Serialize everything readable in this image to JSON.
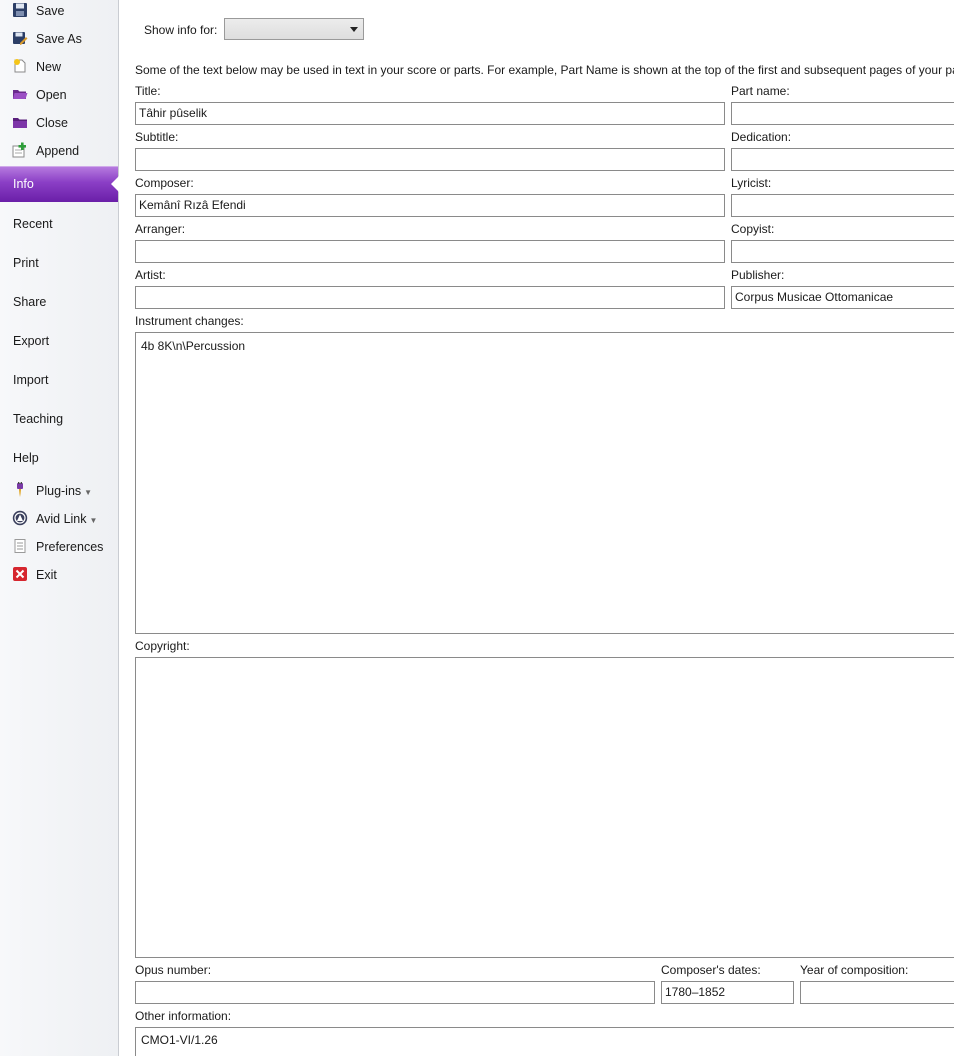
{
  "sidebar": {
    "file_items": [
      {
        "label": "Save",
        "icon": "save-icon"
      },
      {
        "label": "Save As",
        "icon": "save-as-icon"
      },
      {
        "label": "New",
        "icon": "new-icon"
      },
      {
        "label": "Open",
        "icon": "open-folder-icon"
      },
      {
        "label": "Close",
        "icon": "close-folder-icon"
      },
      {
        "label": "Append",
        "icon": "append-icon"
      }
    ],
    "nav": {
      "info": "Info",
      "recent": "Recent",
      "print": "Print",
      "share": "Share",
      "export": "Export",
      "import": "Import",
      "teaching": "Teaching",
      "help": "Help"
    },
    "bottom_items": [
      {
        "label": "Plug-ins",
        "icon": "plugins-icon"
      },
      {
        "label": "Avid Link",
        "icon": "avid-link-icon"
      },
      {
        "label": "Preferences",
        "icon": "preferences-icon"
      },
      {
        "label": "Exit",
        "icon": "exit-icon"
      }
    ],
    "active_color": "#8b3fc6"
  },
  "main": {
    "show_info_label": "Show info for:",
    "show_info_value": "",
    "description": "Some of the text below may be used in text in your score or parts. For example, Part Name is shown at the top of the first and subsequent pages of your parts.",
    "fields": {
      "title": {
        "label": "Title:",
        "value": "Tâhir pûselik"
      },
      "part_name": {
        "label": "Part name:",
        "value": ""
      },
      "subtitle": {
        "label": "Subtitle:",
        "value": ""
      },
      "dedication": {
        "label": "Dedication:",
        "value": ""
      },
      "composer": {
        "label": "Composer:",
        "value": "Kemânî Rızâ Efendi"
      },
      "lyricist": {
        "label": "Lyricist:",
        "value": ""
      },
      "arranger": {
        "label": "Arranger:",
        "value": ""
      },
      "copyist": {
        "label": "Copyist:",
        "value": ""
      },
      "artist": {
        "label": "Artist:",
        "value": ""
      },
      "publisher": {
        "label": "Publisher:",
        "value": "Corpus Musicae Ottomanicae"
      },
      "instrument_changes": {
        "label": "Instrument changes:",
        "value": "4b 8K\\n\\Percussion"
      },
      "copyright": {
        "label": "Copyright:",
        "value": ""
      },
      "opus_number": {
        "label": "Opus number:",
        "value": ""
      },
      "composers_dates": {
        "label": "Composer's dates:",
        "value": "1780–1852"
      },
      "year_of_composition": {
        "label": "Year of composition:",
        "value": ""
      },
      "other_information": {
        "label": "Other information:",
        "value": "CMO1-VI/1.26"
      }
    }
  }
}
